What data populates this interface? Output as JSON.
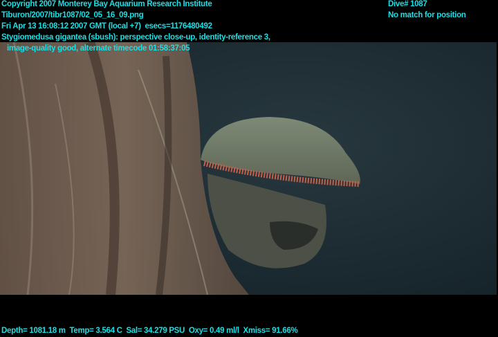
{
  "overlay": {
    "copyright": "Copyright 2007 Monterey Bay Aquarium Research Institute",
    "file_path": "Tiburon/2007/tibr1087/02_05_16_09.png",
    "timestamp": "Fri Apr 13 16:08:12 2007 GMT (local +7)  esecs=1176480492",
    "annotation_line1": "Stygiomedusa gigantea (sbush): perspective close-up, identity-reference 3,",
    "annotation_line2": "image-quality good, alternate timecode 01:58:37:05",
    "dive": "Dive# 1087",
    "position": "No match for position",
    "sensors": "Depth= 1081.18 m  Temp= 3.564 C  Sal= 34.279 PSU  Oxy= 0.49 ml/l  Xmiss= 91.66%"
  },
  "colors": {
    "text": "#19e0e6",
    "water": "#1c2c34",
    "background": "#000000"
  }
}
